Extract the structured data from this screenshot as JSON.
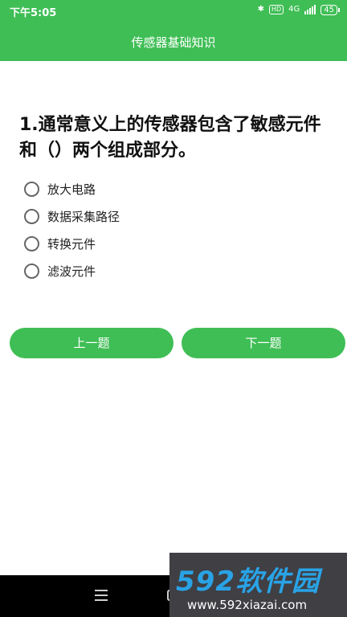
{
  "status_bar": {
    "time": "下午5:05",
    "bluetooth": "✱",
    "hd": "HD",
    "network": "4G",
    "battery": "45"
  },
  "app_bar": {
    "title": "传感器基础知识"
  },
  "question": {
    "text": "1.通常意义上的传感器包含了敏感元件和（）两个组成部分。",
    "options": [
      {
        "label": "放大电路"
      },
      {
        "label": "数据采集路径"
      },
      {
        "label": "转换元件"
      },
      {
        "label": "滤波元件"
      }
    ]
  },
  "buttons": {
    "prev": "上一题",
    "next": "下一题"
  },
  "watermark": {
    "logo": "592软件园",
    "url": "www.592xiazai.com"
  },
  "colors": {
    "accent": "#3fbe55",
    "nav_bar": "#000000"
  }
}
